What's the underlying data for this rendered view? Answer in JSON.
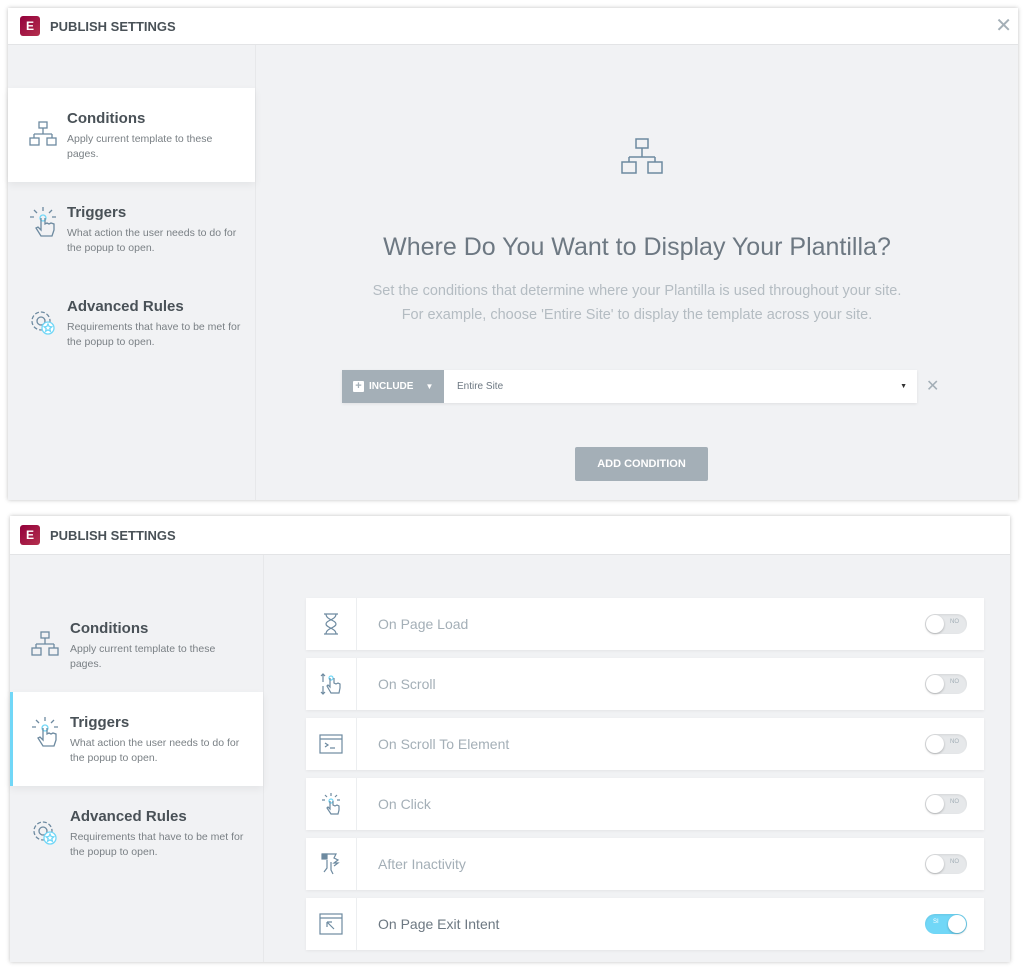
{
  "top": {
    "title": "PUBLISH SETTINGS",
    "logo": "E",
    "sidebar": [
      {
        "title": "Conditions",
        "desc": "Apply current template to these pages.",
        "icon": "sitemap-icon"
      },
      {
        "title": "Triggers",
        "desc": "What action the user needs to do for the popup to open.",
        "icon": "click-hand-icon"
      },
      {
        "title": "Advanced Rules",
        "desc": "Requirements that have to be met for the popup to open.",
        "icon": "gear-star-icon"
      }
    ],
    "heading": "Where Do You Want to Display Your Plantilla?",
    "sub1": "Set the conditions that determine where your Plantilla is used throughout your site.",
    "sub2": "For example, choose 'Entire Site' to display the template across your site.",
    "include_label": "INCLUDE",
    "condition_value": "Entire Site",
    "add_condition": "ADD CONDITION"
  },
  "bottom": {
    "title": "PUBLISH SETTINGS",
    "logo": "E",
    "sidebar": [
      {
        "title": "Conditions",
        "desc": "Apply current template to these pages."
      },
      {
        "title": "Triggers",
        "desc": "What action the user needs to do for the popup to open."
      },
      {
        "title": "Advanced Rules",
        "desc": "Requirements that have to be met for the popup to open."
      }
    ],
    "triggers": [
      {
        "label": "On Page Load",
        "icon": "hourglass-icon",
        "enabled": false,
        "toggle": "NO"
      },
      {
        "label": "On Scroll",
        "icon": "scroll-hand-icon",
        "enabled": false,
        "toggle": "NO"
      },
      {
        "label": "On Scroll To Element",
        "icon": "terminal-window-icon",
        "enabled": false,
        "toggle": "NO"
      },
      {
        "label": "On Click",
        "icon": "click-hand-icon",
        "enabled": false,
        "toggle": "NO"
      },
      {
        "label": "After Inactivity",
        "icon": "idle-hand-icon",
        "enabled": false,
        "toggle": "NO"
      },
      {
        "label": "On Page Exit Intent",
        "icon": "exit-cursor-icon",
        "enabled": true,
        "toggle": "SI"
      }
    ]
  },
  "colors": {
    "brand": "#92003b",
    "accent": "#71d7f7",
    "button": "#a4afb7"
  }
}
